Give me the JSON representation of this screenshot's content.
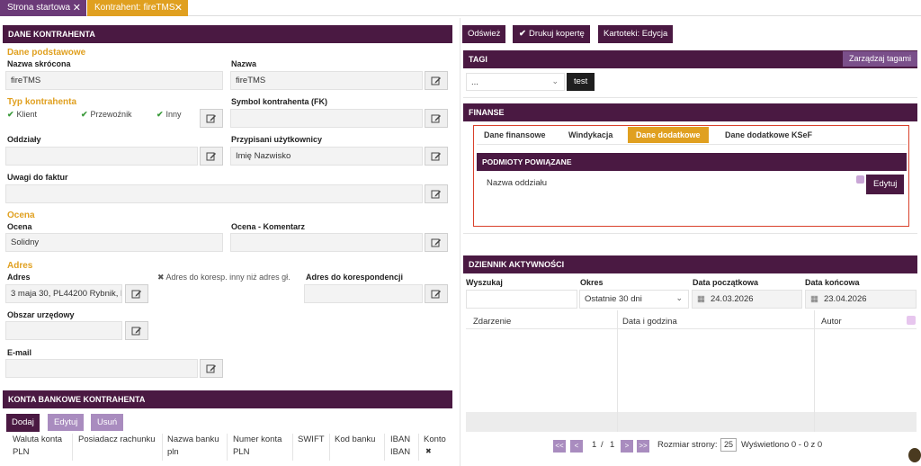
{
  "tabs": [
    {
      "label": "Strona startowa",
      "close": "✕"
    },
    {
      "label": "Kontrahent: fireTMS",
      "close": "✕"
    }
  ],
  "left": {
    "header": "DANE KONTRAHENTA",
    "basic_section": "Dane podstawowe",
    "short_name_label": "Nazwa skrócona",
    "short_name_value": "fireTMS",
    "name_label": "Nazwa",
    "name_value": "fireTMS",
    "type_section": "Typ kontrahenta",
    "types": [
      {
        "check": "✔",
        "label": "Klient"
      },
      {
        "check": "✔",
        "label": "Przewoźnik"
      },
      {
        "check": "✔",
        "label": "Inny"
      }
    ],
    "fk_label": "Symbol kontrahenta (FK)",
    "fk_value": "",
    "branches_label": "Oddziały",
    "branches_value": "",
    "users_label": "Przypisani użytkownicy",
    "users_value": "Imię Nazwisko",
    "invoice_notes_label": "Uwagi do faktur",
    "invoice_notes_value": "",
    "rating_section": "Ocena",
    "rating_label": "Ocena",
    "rating_value": "Solidny",
    "rating_comment_label": "Ocena - Komentarz",
    "rating_comment_value": "",
    "address_section": "Adres",
    "address_label": "Adres",
    "address_value": "3 maja 30, PL44200 Rybnik, P",
    "corr_flag": "✖ Adres do koresp. inny niż adres gł.",
    "corr_label": "Adres do korespondencji",
    "corr_value": "",
    "office_label": "Obszar urzędowy",
    "office_value": "",
    "email_label": "E-mail",
    "email_value": ""
  },
  "bank": {
    "header": "KONTA BANKOWE KONTRAHENTA",
    "add": "Dodaj",
    "edit": "Edytuj",
    "remove": "Usuń",
    "columns": [
      "Waluta konta",
      "Posiadacz rachunku",
      "Nazwa banku",
      "Numer konta",
      "SWIFT",
      "Kod banku",
      "IBAN",
      "Konto"
    ],
    "row": [
      "PLN",
      "",
      "pln",
      "PLN",
      "",
      "",
      "IBAN",
      "✖"
    ]
  },
  "toolbar": {
    "refresh": "Odśwież",
    "print_envelope": "Drukuj kopertę",
    "cards": "Kartoteki: Edycja"
  },
  "tags": {
    "header": "TAGI",
    "manage": "Zarządzaj tagami",
    "select_value": "...",
    "tag": "test"
  },
  "finance": {
    "header": "FINANSE",
    "tabs": [
      "Dane finansowe",
      "Windykacja",
      "Dane dodatkowe",
      "Dane dodatkowe KSeF"
    ],
    "active_tab": "Dane dodatkowe",
    "related_header": "PODMIOTY POWIĄZANE",
    "branch_name_label": "Nazwa oddziału",
    "edit": "Edytuj"
  },
  "activity": {
    "header": "DZIENNIK AKTYWNOŚCI",
    "search_label": "Wyszukaj",
    "search_value": "",
    "period_label": "Okres",
    "period_value": "Ostatnie 30 dni",
    "start_label": "Data początkowa",
    "start_value": "24.03.2026",
    "end_label": "Data końcowa",
    "end_value": "23.04.2026",
    "col_event": "Zdarzenie",
    "col_datetime": "Data i godzina",
    "col_author": "Autor",
    "pager": {
      "first": "<<",
      "prev": "<",
      "page": "1",
      "slash": "/",
      "total": "1",
      "next": ">",
      "last": ">>",
      "size_label": "Rozmiar strony:",
      "size_value": "25",
      "shown": "Wyświetlono 0 - 0 z 0"
    }
  },
  "colors": {
    "primary": "#4a1942",
    "accent": "#e0a020",
    "light_purple": "#a98cbf",
    "highlight": "#d9402b"
  }
}
